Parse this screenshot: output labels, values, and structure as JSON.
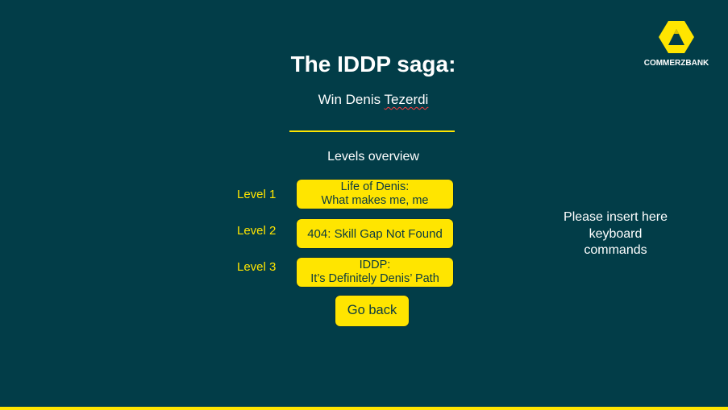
{
  "brand": {
    "logo_text": "COMMERZBANK",
    "logo_color": "#ffe500"
  },
  "header": {
    "title": "The IDDP saga:",
    "subtitle_prefix": "Win Denis ",
    "subtitle_surname": "Tezerdi"
  },
  "levels": {
    "heading": "Levels overview",
    "items": [
      {
        "label": "Level 1",
        "line1": "Life of Denis:",
        "line2": "What makes me, me"
      },
      {
        "label": "Level 2",
        "line1": "404: Skill Gap Not Found",
        "line2": ""
      },
      {
        "label": "Level 3",
        "line1": "IDDP:",
        "line2": "It’s Definitely Denis’ Path"
      }
    ]
  },
  "actions": {
    "go_back_label": "Go back"
  },
  "notes": {
    "keyboard_line1": "Please insert here",
    "keyboard_line2": "keyboard",
    "keyboard_line3": "commands"
  },
  "colors": {
    "background": "#023d48",
    "accent": "#ffe500",
    "text": "#ffffff",
    "button_text": "#0b3a40"
  }
}
